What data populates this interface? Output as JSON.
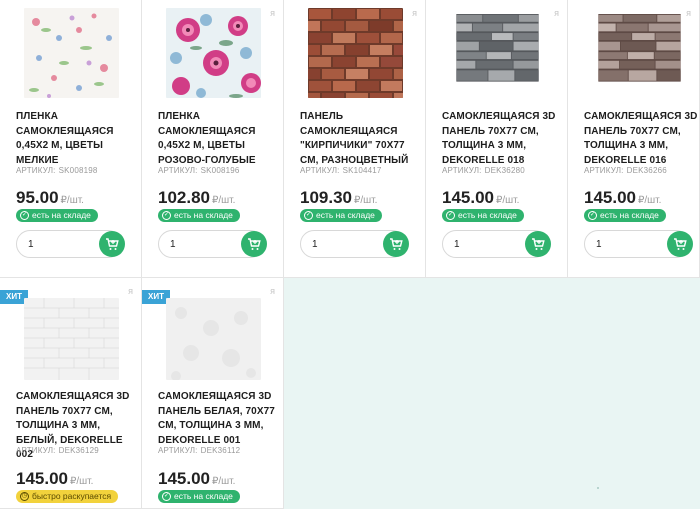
{
  "products": [
    {
      "title": "ПЛЕНКА САМОКЛЕЯЩАЯСЯ 0,45Х2 М, ЦВЕТЫ МЕЛКИЕ",
      "sku_label": "АРТИКУЛ:",
      "sku": "SK008198",
      "price": "95.00",
      "unit": "₽/шт.",
      "stock": "есть на складе",
      "qty": "1",
      "fav_icon": "я",
      "image": "floral-small"
    },
    {
      "title": "ПЛЕНКА САМОКЛЕЯЩАЯСЯ 0,45Х2 М, ЦВЕТЫ РОЗОВО-ГОЛУБЫЕ",
      "sku_label": "АРТИКУЛ:",
      "sku": "SK008196",
      "price": "102.80",
      "unit": "₽/шт.",
      "stock": "есть на складе",
      "qty": "1",
      "fav_icon": "я",
      "image": "floral-pink"
    },
    {
      "title": "ПАНЕЛЬ САМОКЛЕЯЩАЯСЯ \"КИРПИЧИКИ\" 70Х77 СМ, РАЗНОЦВЕТНЫЙ",
      "sku_label": "АРТИКУЛ:",
      "sku": "SK104417",
      "price": "109.30",
      "unit": "₽/шт.",
      "stock": "есть на складе",
      "qty": "1",
      "fav_icon": "я",
      "image": "brick-red"
    },
    {
      "title": "САМОКЛЕЯЩАЯСЯ 3D ПАНЕЛЬ 70Х77 СМ, ТОЛЩИНА 3 ММ, DEKORELLE 018",
      "sku_label": "АРТИКУЛ:",
      "sku": "DEK36280",
      "price": "145.00",
      "unit": "₽/шт.",
      "stock": "есть на складе",
      "qty": "1",
      "fav_icon": "я",
      "image": "stone-gray"
    },
    {
      "title": "САМОКЛЕЯЩАЯСЯ 3D ПАНЕЛЬ 70Х77 СМ, ТОЛЩИНА 3 ММ, DEKORELLE 016",
      "sku_label": "АРТИКУЛ:",
      "sku": "DEK36266",
      "price": "145.00",
      "unit": "₽/шт.",
      "stock": "есть на складе",
      "qty": "1",
      "fav_icon": "я",
      "image": "stone-brown"
    },
    {
      "title": "САМОКЛЕЯЩАЯСЯ 3D ПАНЕЛЬ 70Х77 СМ, ТОЛЩИНА 3 ММ, БЕЛЫЙ, DEKORELLE 002",
      "sku_label": "АРТИКУЛ:",
      "sku": "DEK36129",
      "price": "145.00",
      "unit": "₽/шт.",
      "stock": "быстро раскупается",
      "stock_color": "#f2d23c",
      "hit": "ХИТ",
      "fav_icon": "я",
      "image": "white-brick"
    },
    {
      "title": "САМОКЛЕЯЩАЯСЯ 3D ПАНЕЛЬ БЕЛАЯ, 70Х77 СМ, ТОЛЩИНА 3 ММ, DEKORELLE 001",
      "sku_label": "АРТИКУЛ:",
      "sku": "DEK36112",
      "price": "145.00",
      "unit": "₽/шт.",
      "stock": "есть на складе",
      "hit": "ХИТ",
      "fav_icon": "я",
      "image": "white-plain"
    }
  ],
  "colors": {
    "accent": "#2fb36e",
    "hit": "#3aa3d6",
    "background": "#e9f5f3"
  }
}
